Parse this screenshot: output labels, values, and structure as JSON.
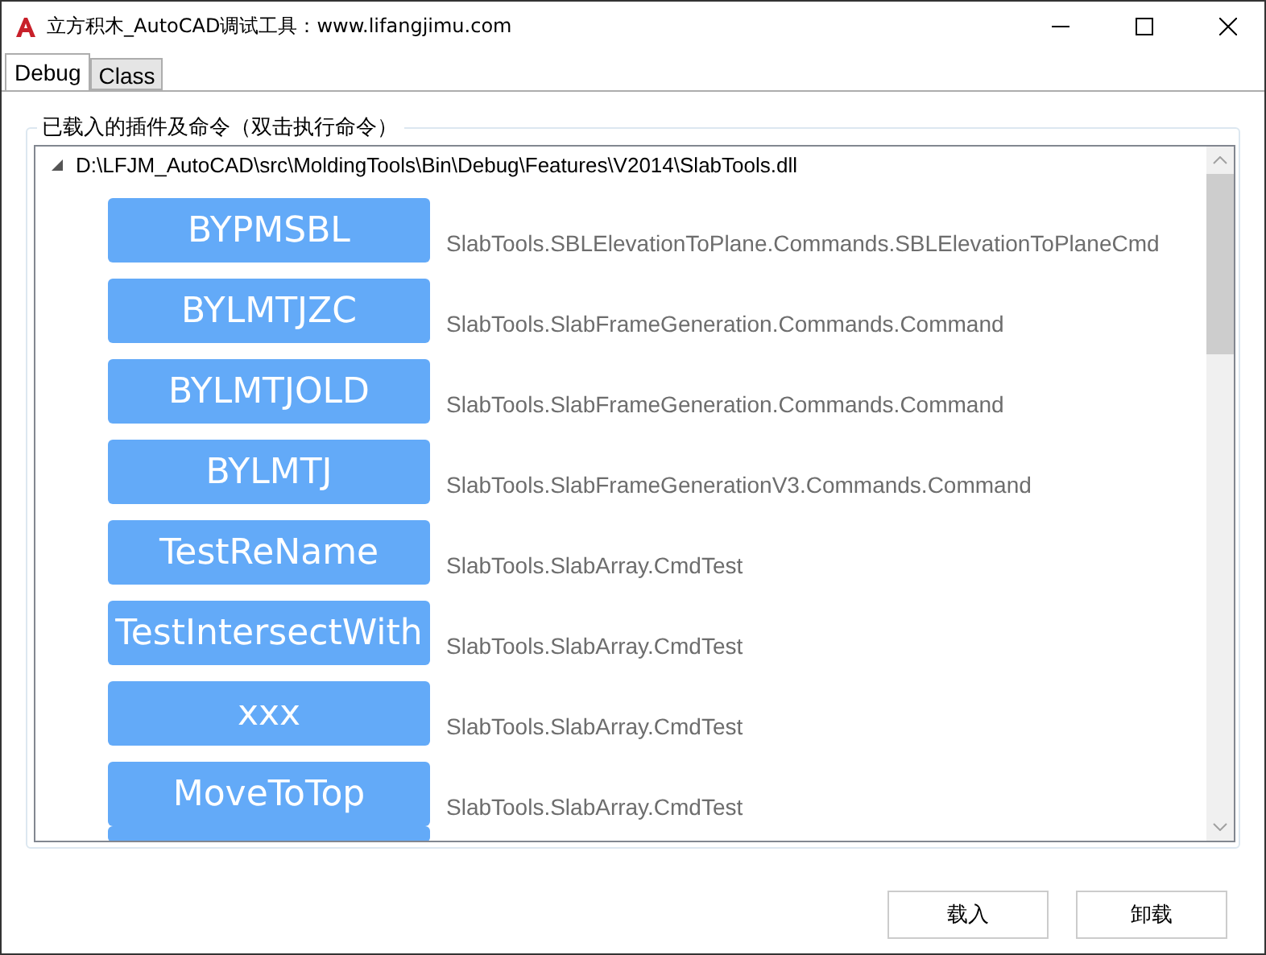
{
  "window": {
    "title": "立方积木_AutoCAD调试工具：www.lifangjimu.com"
  },
  "tabs": [
    {
      "label": "Debug",
      "selected": true
    },
    {
      "label": "Class",
      "selected": false
    }
  ],
  "group": {
    "title": "已载入的插件及命令（双击执行命令）",
    "tree": {
      "label": "D:\\LFJM_AutoCAD\\src\\MoldingTools\\Bin\\Debug\\Features\\V2014\\SlabTools.dll",
      "expanded": true,
      "children": [
        {
          "command": "BYPMSBL",
          "class": "SlabTools.SBLElevationToPlane.Commands.SBLElevationToPlaneCmd"
        },
        {
          "command": "BYLMTJZC",
          "class": "SlabTools.SlabFrameGeneration.Commands.Command"
        },
        {
          "command": "BYLMTJOLD",
          "class": "SlabTools.SlabFrameGeneration.Commands.Command"
        },
        {
          "command": "BYLMTJ",
          "class": "SlabTools.SlabFrameGenerationV3.Commands.Command"
        },
        {
          "command": "TestReName",
          "class": "SlabTools.SlabArray.CmdTest"
        },
        {
          "command": "TestIntersectWith",
          "class": "SlabTools.SlabArray.CmdTest"
        },
        {
          "command": "xxx",
          "class": "SlabTools.SlabArray.CmdTest"
        },
        {
          "command": "MoveToTop",
          "class": "SlabTools.SlabArray.CmdTest"
        }
      ]
    }
  },
  "buttons": [
    "载入",
    "卸载"
  ]
}
